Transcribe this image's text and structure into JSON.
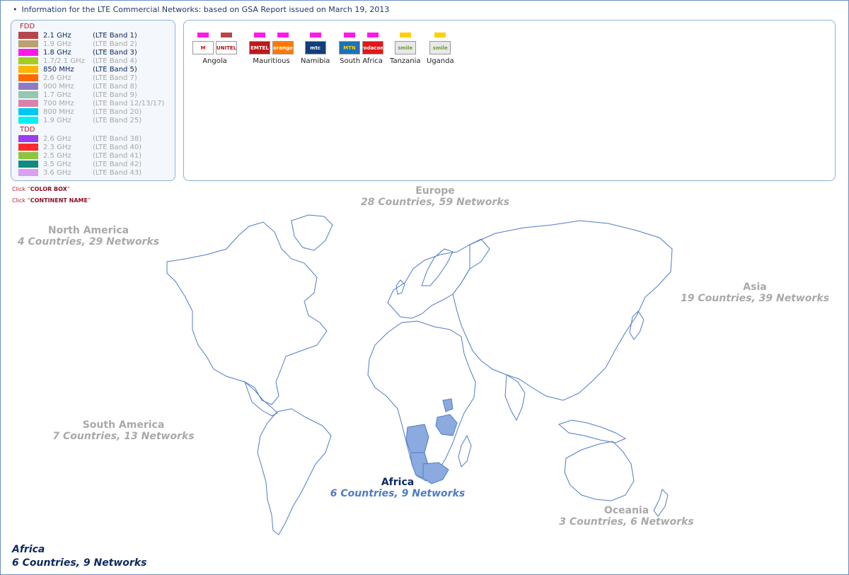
{
  "header": {
    "info": "Information for the LTE Commercial Networks: based on GSA Report issued on March 19, 2013"
  },
  "legend": {
    "fdd_title": "FDD",
    "tdd_title": "TDD",
    "fdd": [
      {
        "freq": "2.1 GHz",
        "band": "(LTE Band 1)",
        "color": "#b5474a",
        "active": true
      },
      {
        "freq": "1.9 GHz",
        "band": "(LTE Band 2)",
        "color": "#bba070",
        "active": false
      },
      {
        "freq": "1.8 GHz",
        "band": "(LTE Band 3)",
        "color": "#ff19e8",
        "active": true
      },
      {
        "freq": "1.7/2.1 GHz",
        "band": "(LTE Band 4)",
        "color": "#a6cc22",
        "active": false
      },
      {
        "freq": "850 MHz",
        "band": "(LTE Band 5)",
        "color": "#ffb400",
        "active": true
      },
      {
        "freq": "2.6 GHz",
        "band": "(LTE Band 7)",
        "color": "#ff6a00",
        "active": false
      },
      {
        "freq": "900 MHz",
        "band": "(LTE Band 8)",
        "color": "#8d7cc4",
        "active": false
      },
      {
        "freq": "1.7 GHz",
        "band": "(LTE Band 9)",
        "color": "#94c8b0",
        "active": false
      },
      {
        "freq": "700 MHz",
        "band": "(LTE Band 12/13/17)",
        "color": "#d883ac",
        "active": false
      },
      {
        "freq": "800 MHz",
        "band": "(LTE Band 20)",
        "color": "#00c8f4",
        "active": false
      },
      {
        "freq": "1.9 GHz",
        "band": "(LTE Band 25)",
        "color": "#00f0f8",
        "active": false
      }
    ],
    "tdd": [
      {
        "freq": "2.6 GHz",
        "band": "(LTE Band 38)",
        "color": "#9a3cf0",
        "active": false
      },
      {
        "freq": "2.3 GHz",
        "band": "(LTE Band 40)",
        "color": "#ff2a2a",
        "active": false
      },
      {
        "freq": "2.5 GHz",
        "band": "(LTE Band 41)",
        "color": "#8cc63e",
        "active": false
      },
      {
        "freq": "3.5 GHz",
        "band": "(LTE Band 42)",
        "color": "#118a80",
        "active": false
      },
      {
        "freq": "3.6 GHz",
        "band": "(LTE Band 43)",
        "color": "#d8a0f0",
        "active": false
      }
    ]
  },
  "hints": {
    "color_box_prefix": "Click “",
    "color_box": "COLOR BOX",
    "color_box_suffix": "”",
    "continent_prefix": "Click “",
    "continent": "CONTINENT NAME",
    "continent_suffix": "”"
  },
  "operators": [
    {
      "country": "Angola",
      "ops": [
        {
          "text": "M",
          "marker": "#ff19e8",
          "bg": "#ffffff",
          "fg": "#e01010"
        },
        {
          "text": "UNITEL",
          "marker": "#b5474a",
          "bg": "#ffffff",
          "fg": "#b01010"
        }
      ]
    },
    {
      "country": "Mauritious",
      "ops": [
        {
          "text": "EMTEL",
          "marker": "#ff19e8",
          "bg": "#c01818",
          "fg": "#ffffff"
        },
        {
          "text": "orange",
          "marker": "#ff19e8",
          "bg": "#ff7900",
          "fg": "#ffffff"
        }
      ]
    },
    {
      "country": "Namibia",
      "ops": [
        {
          "text": "mtc",
          "marker": "#ff19e8",
          "bg": "#123e7a",
          "fg": "#ffffff"
        }
      ]
    },
    {
      "country": "South Africa",
      "ops": [
        {
          "text": "MTN",
          "marker": "#ff19e8",
          "bg": "#1a72b8",
          "fg": "#ffd000"
        },
        {
          "text": "vodacom",
          "marker": "#ff19e8",
          "bg": "#e01818",
          "fg": "#ffffff"
        }
      ]
    },
    {
      "country": "Tanzania",
      "ops": [
        {
          "text": "smile",
          "marker": "#ffd000",
          "bg": "#e8e8e8",
          "fg": "#6aa030"
        }
      ]
    },
    {
      "country": "Uganda",
      "ops": [
        {
          "text": "smile",
          "marker": "#ffd000",
          "bg": "#e8e8e8",
          "fg": "#6aa030"
        }
      ]
    }
  ],
  "continents": {
    "europe": {
      "name": "Europe",
      "stats": "28 Countries, 59 Networks",
      "active": false
    },
    "north_america": {
      "name": "North America",
      "stats": "4 Countries, 29 Networks",
      "active": false
    },
    "asia": {
      "name": "Asia",
      "stats": "19 Countries, 39 Networks",
      "active": false
    },
    "south_america": {
      "name": "South America",
      "stats": "7 Countries, 13 Networks",
      "active": false
    },
    "africa": {
      "name": "Africa",
      "stats": "6 Countries, 9 Networks",
      "active": true
    },
    "oceania": {
      "name": "Oceania",
      "stats": "3 Countries, 6 Networks",
      "active": false
    }
  },
  "selected": {
    "name": "Africa",
    "stats": "6 Countries, 9 Networks"
  },
  "map_colors": {
    "outline": "#4f7cc4",
    "highlight": "#8aaae0"
  }
}
